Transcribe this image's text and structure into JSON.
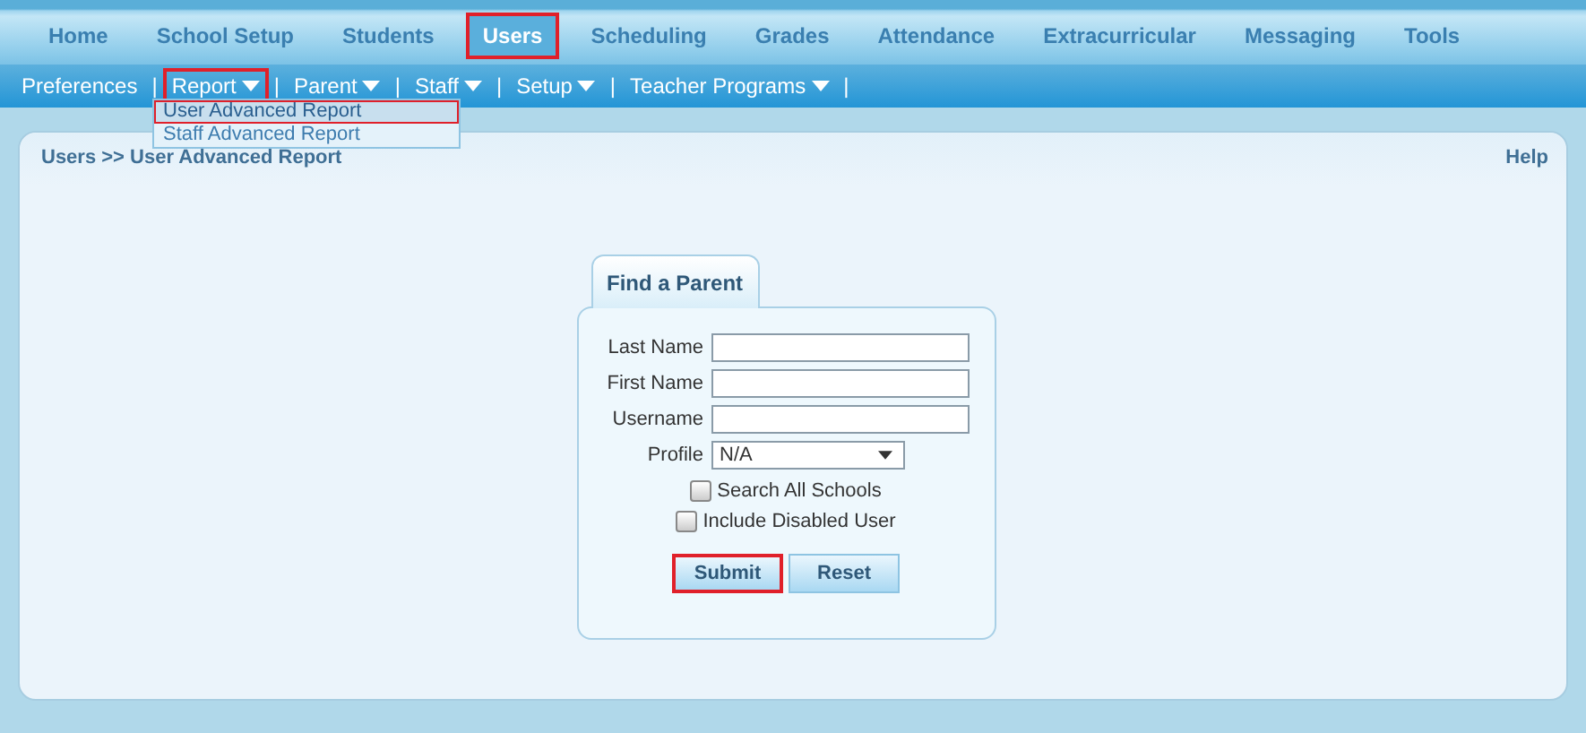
{
  "main_nav": [
    {
      "label": "Home",
      "selected": false,
      "highlighted": false
    },
    {
      "label": "School Setup",
      "selected": false,
      "highlighted": false
    },
    {
      "label": "Students",
      "selected": false,
      "highlighted": false
    },
    {
      "label": "Users",
      "selected": true,
      "highlighted": true
    },
    {
      "label": "Scheduling",
      "selected": false,
      "highlighted": false
    },
    {
      "label": "Grades",
      "selected": false,
      "highlighted": false
    },
    {
      "label": "Attendance",
      "selected": false,
      "highlighted": false
    },
    {
      "label": "Extracurricular",
      "selected": false,
      "highlighted": false
    },
    {
      "label": "Messaging",
      "selected": false,
      "highlighted": false
    },
    {
      "label": "Tools",
      "selected": false,
      "highlighted": false
    }
  ],
  "sub_nav": [
    {
      "kind": "link",
      "label": "Preferences",
      "dropdown": false,
      "highlighted": false
    },
    {
      "kind": "separator",
      "label": "|"
    },
    {
      "kind": "link",
      "label": "Report",
      "dropdown": true,
      "highlighted": true
    },
    {
      "kind": "separator",
      "label": "|"
    },
    {
      "kind": "link",
      "label": "Parent",
      "dropdown": true,
      "highlighted": false
    },
    {
      "kind": "separator",
      "label": "|"
    },
    {
      "kind": "link",
      "label": "Staff",
      "dropdown": true,
      "highlighted": false
    },
    {
      "kind": "separator",
      "label": "|"
    },
    {
      "kind": "link",
      "label": "Setup",
      "dropdown": true,
      "highlighted": false
    },
    {
      "kind": "separator",
      "label": "|"
    },
    {
      "kind": "link",
      "label": "Teacher Programs",
      "dropdown": true,
      "highlighted": false
    },
    {
      "kind": "separator",
      "label": "|"
    }
  ],
  "dropdown_menu": {
    "items": [
      {
        "label": "User Advanced Report",
        "selected": true,
        "highlighted": true
      },
      {
        "label": "Staff Advanced Report",
        "selected": false,
        "highlighted": false
      }
    ]
  },
  "panel": {
    "breadcrumb": "Users >> User Advanced Report",
    "help": "Help"
  },
  "form": {
    "tab": "Find a Parent",
    "fields": [
      {
        "label": "Last Name",
        "kind": "text"
      },
      {
        "label": "First Name",
        "kind": "text"
      },
      {
        "label": "Username",
        "kind": "text"
      },
      {
        "label": "Profile",
        "kind": "select",
        "value": "N/A"
      }
    ],
    "checkboxes": [
      {
        "label": "Search All Schools",
        "checked": false
      },
      {
        "label": "Include Disabled User",
        "checked": false
      }
    ],
    "buttons": [
      {
        "label": "Submit",
        "highlighted": true
      },
      {
        "label": "Reset",
        "highlighted": false
      }
    ]
  }
}
